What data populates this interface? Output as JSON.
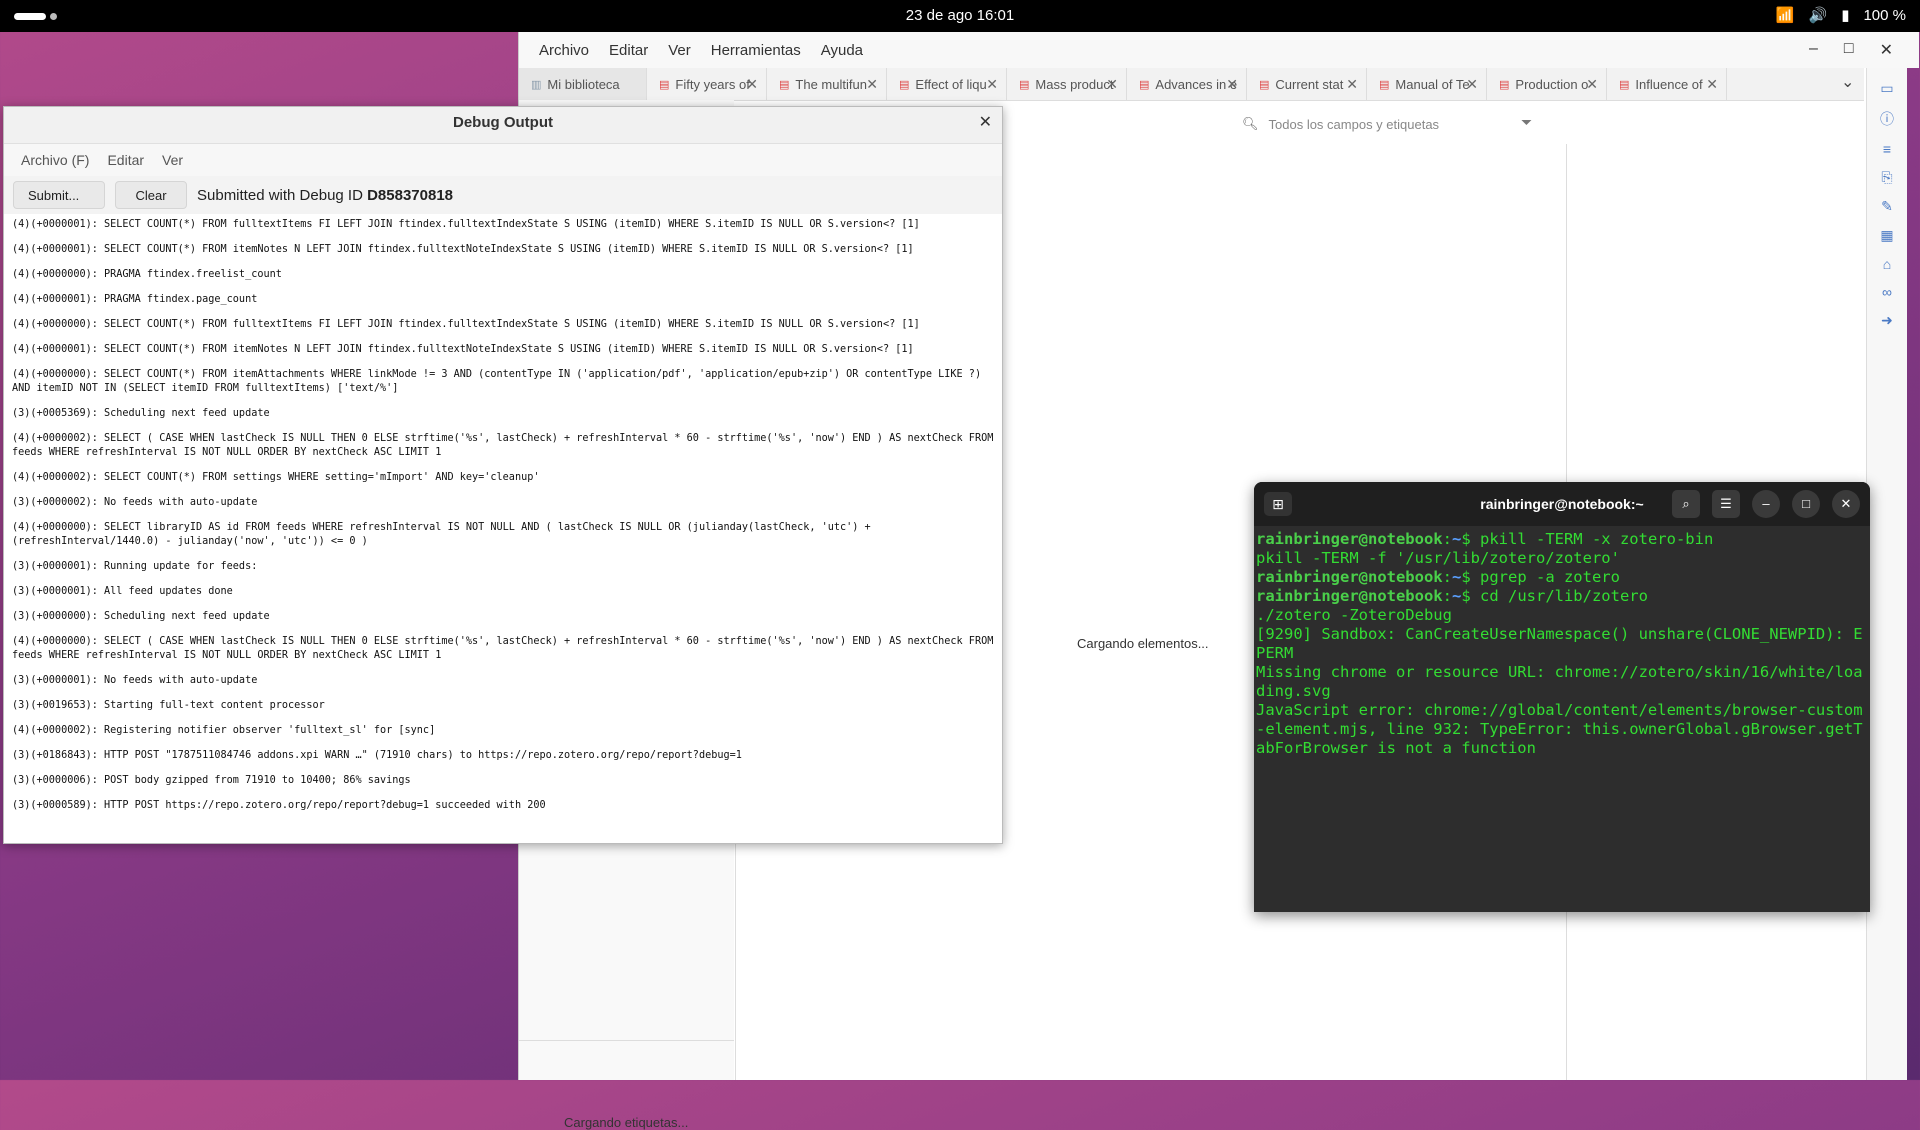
{
  "topbar": {
    "clock": "23 de ago  16:01",
    "battery": "100 %"
  },
  "zotero": {
    "menu": [
      "Archivo",
      "Editar",
      "Ver",
      "Herramientas",
      "Ayuda"
    ],
    "tabs": [
      "Mi biblioteca",
      "Fifty years of",
      "The multifun",
      "Effect of liqu",
      "Mass product",
      "Advances in e",
      "Current stat",
      "Manual of Te",
      "Production o",
      "Influence of"
    ],
    "search_placeholder": "Todos los campos y etiquetas",
    "loading_items": "Cargando elementos...",
    "loading_tags": "Cargando etiquetas..."
  },
  "debug": {
    "title": "Debug Output",
    "menu": [
      "Archivo (F)",
      "Editar",
      "Ver"
    ],
    "submit_label": "Submit...",
    "clear_label": "Clear",
    "status_prefix": "Submitted with Debug ID ",
    "debug_id": "D858370818",
    "log": [
      "(4)(+0000001): SELECT COUNT(*) FROM fulltextItems FI LEFT JOIN ftindex.fulltextIndexState S USING (itemID) WHERE S.itemID IS NULL OR S.version<? [1]",
      "(4)(+0000001): SELECT COUNT(*) FROM itemNotes N LEFT JOIN ftindex.fulltextNoteIndexState S USING (itemID) WHERE S.itemID IS NULL OR S.version<? [1]",
      "(4)(+0000000): PRAGMA ftindex.freelist_count",
      "(4)(+0000001): PRAGMA ftindex.page_count",
      "(4)(+0000000): SELECT COUNT(*) FROM fulltextItems FI LEFT JOIN ftindex.fulltextIndexState S USING (itemID) WHERE S.itemID IS NULL OR S.version<? [1]",
      "(4)(+0000001): SELECT COUNT(*) FROM itemNotes N LEFT JOIN ftindex.fulltextNoteIndexState S USING (itemID) WHERE S.itemID IS NULL OR S.version<? [1]",
      "(4)(+0000000): SELECT COUNT(*) FROM itemAttachments WHERE linkMode != 3 AND (contentType IN ('application/pdf', 'application/epub+zip') OR contentType LIKE ?) AND itemID NOT IN (SELECT itemID FROM fulltextItems) ['text/%']",
      "(3)(+0005369): Scheduling next feed update",
      "(4)(+0000002): SELECT ( CASE WHEN lastCheck IS NULL THEN 0 ELSE strftime('%s', lastCheck) + refreshInterval * 60 - strftime('%s', 'now') END ) AS nextCheck FROM feeds WHERE refreshInterval IS NOT NULL ORDER BY nextCheck ASC LIMIT 1",
      "(4)(+0000002): SELECT COUNT(*) FROM settings WHERE setting='mImport' AND key='cleanup'",
      "(3)(+0000002): No feeds with auto-update",
      "(4)(+0000000): SELECT libraryID AS id FROM feeds WHERE refreshInterval IS NOT NULL AND ( lastCheck IS NULL OR (julianday(lastCheck, 'utc') + (refreshInterval/1440.0) - julianday('now', 'utc')) <= 0 )",
      "(3)(+0000001): Running update for feeds:",
      "(3)(+0000001): All feed updates done",
      "(3)(+0000000): Scheduling next feed update",
      "(4)(+0000000): SELECT ( CASE WHEN lastCheck IS NULL THEN 0 ELSE strftime('%s', lastCheck) + refreshInterval * 60 - strftime('%s', 'now') END ) AS nextCheck FROM feeds WHERE refreshInterval IS NOT NULL ORDER BY nextCheck ASC LIMIT 1",
      "(3)(+0000001): No feeds with auto-update",
      "(3)(+0019653): Starting full-text content processor",
      "(4)(+0000002): Registering notifier observer 'fulltext_sl' for [sync]",
      "(3)(+0186843): HTTP POST \"1787511084746 addons.xpi WARN …\" (71910 chars) to https://repo.zotero.org/repo/report?debug=1",
      "(3)(+0000006): POST body gzipped from 71910 to 10400; 86% savings",
      "(3)(+0000589): HTTP POST https://repo.zotero.org/repo/report?debug=1 succeeded with 200"
    ]
  },
  "terminal": {
    "title": "rainbringer@notebook:~",
    "prompt_user": "rainbringer@notebook",
    "lines": [
      {
        "prompt": true,
        "path": "~",
        "cmd": "pkill -TERM -x zotero-bin"
      },
      {
        "prompt": false,
        "text": "pkill -TERM -f '/usr/lib/zotero/zotero'"
      },
      {
        "prompt": true,
        "path": "~",
        "cmd": "pgrep -a zotero"
      },
      {
        "prompt": true,
        "path": "~",
        "cmd": "cd /usr/lib/zotero"
      },
      {
        "prompt": false,
        "text": "./zotero -ZoteroDebug"
      },
      {
        "prompt": false,
        "text": "[9290] Sandbox: CanCreateUserNamespace() unshare(CLONE_NEWPID): EPERM"
      },
      {
        "prompt": false,
        "text": "Missing chrome or resource URL: chrome://zotero/skin/16/white/loading.svg"
      },
      {
        "prompt": false,
        "text": "JavaScript error: chrome://global/content/elements/browser-custom-element.mjs, line 932: TypeError: this.ownerGlobal.gBrowser.getTabForBrowser is not a function"
      }
    ]
  }
}
